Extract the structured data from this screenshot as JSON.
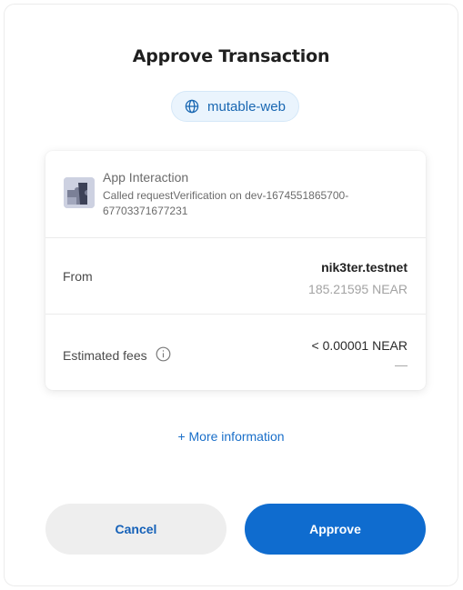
{
  "header": {
    "title": "Approve Transaction"
  },
  "origin": {
    "label": "mutable-web",
    "icon": "globe-icon"
  },
  "app": {
    "icon": "puzzle-icon",
    "title": "App Interaction",
    "description": "Called requestVerification on dev-1674551865700-67703371677231"
  },
  "from": {
    "label": "From",
    "account": "nik3ter.testnet",
    "balance": "185.21595 NEAR"
  },
  "fees": {
    "label": "Estimated fees",
    "icon": "info-icon",
    "amount": "< 0.00001 NEAR",
    "fiat": "—"
  },
  "more_info_label": "+ More information",
  "actions": {
    "cancel_label": "Cancel",
    "approve_label": "Approve"
  },
  "colors": {
    "accent": "#0f6ccf",
    "link": "#1a6fc9",
    "pill_bg": "#eaf4fd"
  }
}
